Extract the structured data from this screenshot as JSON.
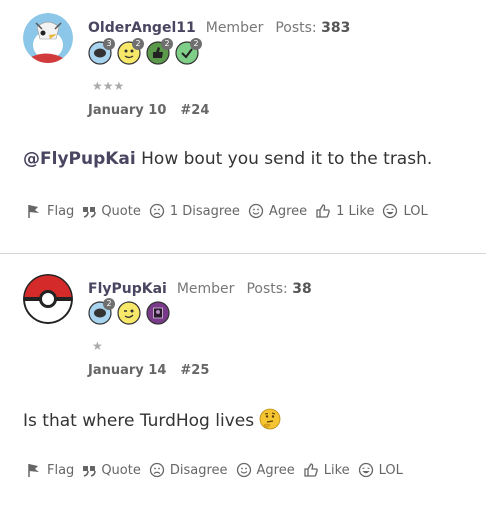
{
  "posts": [
    {
      "author": "OlderAngel11",
      "role": "Member",
      "posts_label": "Posts:",
      "posts_count": "383",
      "badges": [
        {
          "icon": "speech-bubble-icon",
          "count": "3",
          "color": "#a8d4f0"
        },
        {
          "icon": "smiley-face-icon",
          "count": "2",
          "color": "#f7e86a"
        },
        {
          "icon": "thumbs-up-icon",
          "count": "2",
          "color": "#5a9a4a"
        },
        {
          "icon": "checkmark-icon",
          "count": "2",
          "color": "#7fcf88"
        }
      ],
      "stars": "★★★",
      "date": "January 10",
      "post_number": "#24",
      "mention": "@FlyPupKai",
      "message": " How bout you send it to the trash.",
      "actions": {
        "flag": "Flag",
        "quote": "Quote",
        "disagree": "1 Disagree",
        "agree": "Agree",
        "like": "1 Like",
        "lol": "LOL"
      }
    },
    {
      "author": "FlyPupKai",
      "role": "Member",
      "posts_label": "Posts:",
      "posts_count": "38",
      "badges": [
        {
          "icon": "speech-bubble-icon",
          "count": "2",
          "color": "#a8d4f0"
        },
        {
          "icon": "winking-face-icon",
          "count": "",
          "color": "#f7e86a"
        },
        {
          "icon": "photo-badge-icon",
          "count": "",
          "color": "#7a3a8a"
        }
      ],
      "stars": "★",
      "date": "January 14",
      "post_number": "#25",
      "message": "Is that where TurdHog lives ",
      "emoji": "thinking-face-icon",
      "actions": {
        "flag": "Flag",
        "quote": "Quote",
        "disagree": "Disagree",
        "agree": "Agree",
        "like": "Like",
        "lol": "LOL"
      }
    }
  ]
}
